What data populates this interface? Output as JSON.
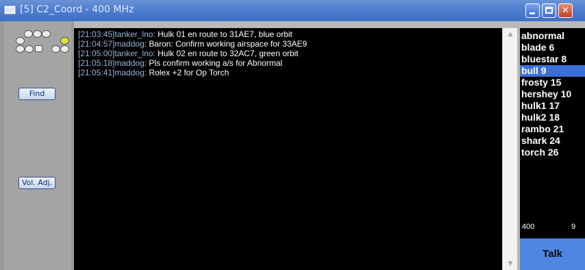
{
  "window": {
    "title": "[5] C2_Coord - 400 MHz"
  },
  "left_panel": {
    "find_label": "Find",
    "vol_label": "Vol. Adj."
  },
  "chat": {
    "lines": [
      {
        "timestamp": "[21:03:45]",
        "user": "tanker_lno:",
        "message": " Hulk 01 en route to 31AE7, blue orbit"
      },
      {
        "timestamp": "[21:04:57]",
        "user": "maddog:",
        "message": " Baron:  Confirm working airspace for 33AE9"
      },
      {
        "timestamp": "[21:05:00]",
        "user": "tanker_lno:",
        "message": " Hulk 02 en route to 32AC7, green orbit"
      },
      {
        "timestamp": "[21:05:18]",
        "user": "maddog:",
        "message": " Pls confirm working a/s for Abnormal"
      },
      {
        "timestamp": "[21:05:41]",
        "user": "maddog:",
        "message": " Rolex +2 for Op Torch"
      }
    ]
  },
  "roster": {
    "items": [
      {
        "label": "abnormal"
      },
      {
        "label": "blade 6"
      },
      {
        "label": "bluestar 8"
      },
      {
        "label": "bull 9",
        "selected": true
      },
      {
        "label": "frosty 15"
      },
      {
        "label": "hershey 10"
      },
      {
        "label": "hulk1 17"
      },
      {
        "label": "hulk2 18"
      },
      {
        "label": "rambo 21"
      },
      {
        "label": "shark 24"
      },
      {
        "label": "torch 26"
      }
    ]
  },
  "status": {
    "frequency": "400",
    "count": "9"
  },
  "talk_label": "Talk",
  "colors": {
    "titlebar": "#4f7ecf",
    "chat_background": "#000000",
    "roster_selected": "#3a6fd8",
    "talk_button": "#4f86e4"
  }
}
